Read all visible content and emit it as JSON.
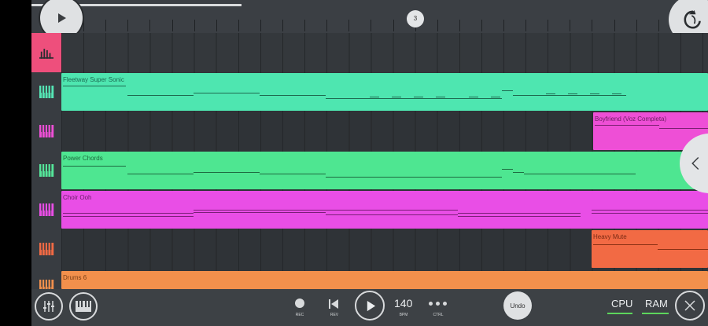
{
  "timeline": {
    "position_marker": "3",
    "playback_progress": 0.31
  },
  "tracks": [
    {
      "clip_name": "",
      "kind": "mixer"
    },
    {
      "clip_name": "Fleetway Super Sonic",
      "color": "#4ee6b0",
      "icon_color": "#55e6b5"
    },
    {
      "clip_name": "Boyfriend (Voz Completa)",
      "color": "#ee4fd6",
      "icon_color": "#ee4fd6"
    },
    {
      "clip_name": "Power Chords",
      "color": "#4ee691",
      "icon_color": "#55e69a"
    },
    {
      "clip_name": "Choir Ooh",
      "color": "#e94ee6",
      "icon_color": "#e94ee6"
    },
    {
      "clip_name": "Heavy Mute",
      "color": "#f26a44",
      "icon_color": "#f26a44"
    },
    {
      "clip_name": "Drums 6",
      "color": "#f2904c",
      "icon_color": "#f2904c"
    }
  ],
  "transport": {
    "rec_label": "REC",
    "rev_label": "REV",
    "bpm_value": "140",
    "bpm_label": "BPM",
    "ctrl_label": "CTRL",
    "undo_label": "Undo",
    "cpu_label": "CPU",
    "ram_label": "RAM"
  },
  "colors": {
    "accent": "#ee4f7c",
    "meter": "#5cd65c"
  }
}
